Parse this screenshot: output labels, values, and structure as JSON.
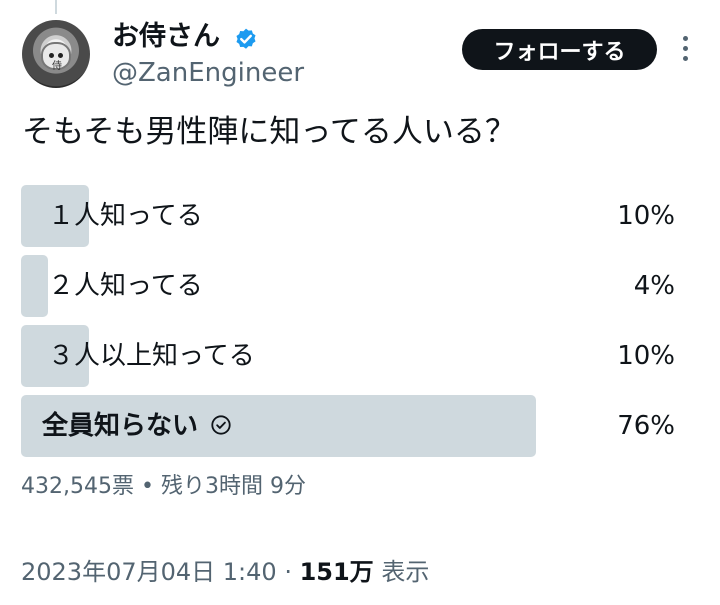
{
  "author": {
    "display_name": "お侍さん",
    "handle": "@ZanEngineer",
    "avatar_glyph": "侍"
  },
  "follow_label": "フォローする",
  "tweet_text": "そもそも男性陣に知ってる人いる？",
  "poll": {
    "options": [
      {
        "label": "１人知ってる",
        "percent_label": "10%",
        "percent": 10
      },
      {
        "label": "２人知ってる",
        "percent_label": "4%",
        "percent": 4
      },
      {
        "label": "３人以上知ってる",
        "percent_label": "10%",
        "percent": 10
      },
      {
        "label": "全員知らない",
        "percent_label": "76%",
        "percent": 76,
        "winner": true
      }
    ],
    "votes": "432,545票",
    "separator": " • ",
    "time_left": "残り3時間 9分"
  },
  "meta": {
    "timestamp": "2023年07月04日 1:40",
    "separator": " · ",
    "views": "151万",
    "views_suffix": " 表示"
  },
  "colors": {
    "accent": "#1d9bf0",
    "bar": "#cfd9de",
    "secondary_text": "#536471",
    "primary_text": "#0f1419"
  },
  "icons": {
    "verified": "verified-badge-icon",
    "more": "more-options-icon",
    "winner": "check-circle-icon"
  }
}
